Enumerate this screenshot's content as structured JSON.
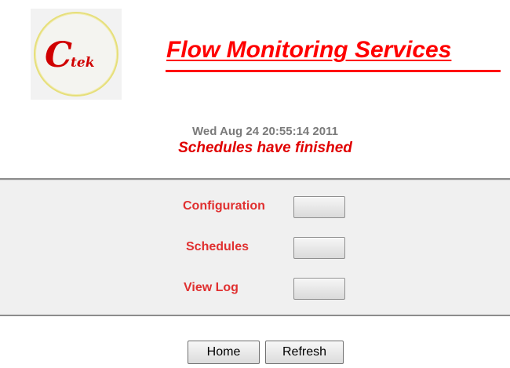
{
  "header": {
    "logo": {
      "main": "C",
      "suffix": "tek"
    },
    "title": "Flow Monitoring Services"
  },
  "status": {
    "timestamp": "Wed Aug 24 20:55:14 2011",
    "message": "Schedules have finished"
  },
  "menu": {
    "items": [
      {
        "label": "Configuration"
      },
      {
        "label": "Schedules"
      },
      {
        "label": "View Log"
      }
    ]
  },
  "footer": {
    "home_label": "Home",
    "refresh_label": "Refresh"
  },
  "colors": {
    "accent": "#ff0000",
    "label": "#e03030",
    "timestamp": "#7a7a7a",
    "panel": "#f0f0f0"
  }
}
